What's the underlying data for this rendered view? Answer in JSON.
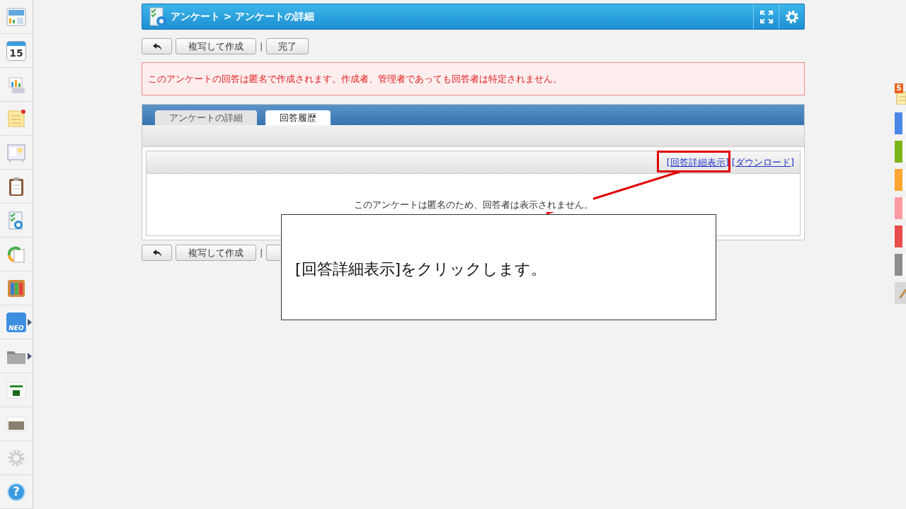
{
  "sidebar": {
    "items": [
      {
        "kind": "portal"
      },
      {
        "kind": "calendar",
        "label": "15"
      },
      {
        "kind": "chart"
      },
      {
        "kind": "memo"
      },
      {
        "kind": "board"
      },
      {
        "kind": "clipboard"
      },
      {
        "kind": "survey"
      },
      {
        "kind": "workflow"
      },
      {
        "kind": "binder"
      },
      {
        "kind": "neo",
        "label": "NEO",
        "has_submenu": true
      },
      {
        "kind": "folder",
        "has_submenu": true
      },
      {
        "kind": "logo"
      },
      {
        "kind": "photo"
      },
      {
        "kind": "settings",
        "disabled": true
      },
      {
        "kind": "help",
        "label": "?"
      }
    ]
  },
  "header": {
    "breadcrumb": "アンケート > アンケートの詳細"
  },
  "toolbar_top": {
    "buttons": [
      {
        "kind": "back"
      },
      {
        "kind": "text",
        "label": "複写して作成"
      },
      {
        "kind": "separator",
        "label": "|"
      },
      {
        "kind": "text",
        "label": "完了"
      }
    ]
  },
  "notice": "このアンケートの回答は匿名で作成されます。作成者、管理者であっても回答者は特定されません。",
  "tabs": [
    {
      "label": "アンケートの詳細",
      "selected": false
    },
    {
      "label": "回答履歴",
      "selected": true
    }
  ],
  "list_links": [
    "[回答詳細表示]",
    "[ダウンロード]"
  ],
  "list_message": "このアンケートは匿名のため、回答者は表示されません。",
  "toolbar_bottom": {
    "buttons": [
      {
        "kind": "back"
      },
      {
        "kind": "text",
        "label": "複写して作成"
      },
      {
        "kind": "separator",
        "label": "|"
      },
      {
        "kind": "covered"
      }
    ]
  },
  "callout": {
    "text": "[回答詳細表示]をクリックします。"
  },
  "right_tabs": [
    {
      "kind": "memo",
      "badge": "5"
    },
    {
      "kind": "color",
      "color": "#4a86e8"
    },
    {
      "kind": "color",
      "color": "#7cb518"
    },
    {
      "kind": "color",
      "color": "#ffa530"
    },
    {
      "kind": "color",
      "color": "#ff9aa2"
    },
    {
      "kind": "color",
      "color": "#e84c4c"
    },
    {
      "kind": "color",
      "color": "#8c8c8c"
    },
    {
      "kind": "pencil"
    }
  ]
}
